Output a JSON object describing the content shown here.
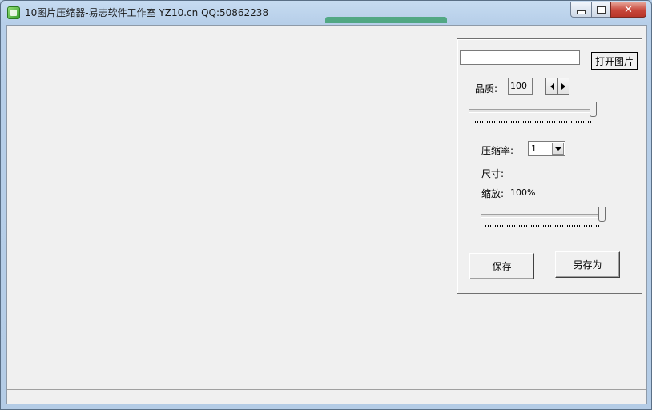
{
  "window": {
    "title": "10图片压缩器-易志软件工作室 YZ10.cn   QQ:50862238",
    "close_glyph": "✕"
  },
  "panel": {
    "path_input": {
      "value": "",
      "placeholder": ""
    },
    "open_button": "打开图片",
    "quality_label": "品质:",
    "quality_value": "100",
    "quality_slider_value": 100,
    "compression_label": "压缩率:",
    "compression_value": "1",
    "size_label": "尺寸:",
    "scale_label": "缩放:",
    "scale_value": "100%",
    "scale_slider_value": 100,
    "save_button": "保存",
    "save_as_button": "另存为"
  },
  "icons": {
    "app": "green-picture-icon",
    "minimize": "minimize-icon",
    "maximize": "maximize-icon",
    "close": "close-icon",
    "spin_left": "arrow-left-icon",
    "spin_right": "arrow-right-icon",
    "dropdown": "chevron-down-icon"
  }
}
